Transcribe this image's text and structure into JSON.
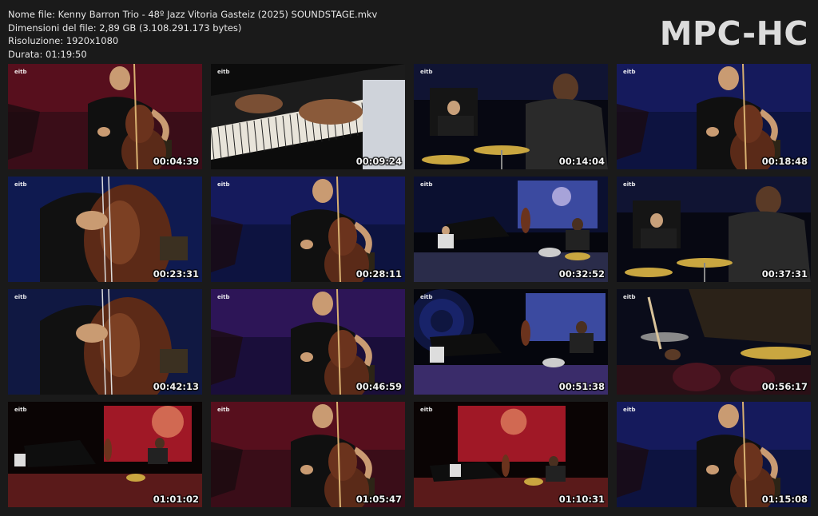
{
  "info": {
    "filename": "Nome file: Kenny Barron Trio - 48º Jazz Vitoria Gasteiz (2025) SOUNDSTAGE.mkv",
    "filesize": "Dimensioni del file: 2,89 GB (3.108.291.173 bytes)",
    "resolution": "Risoluzione: 1920x1080",
    "duration": "Durata: 01:19:50"
  },
  "brand": "MPC-HC",
  "channel_logo": "eitb",
  "thumbnails": [
    {
      "time": "00:04:39",
      "scene": "bassist-red"
    },
    {
      "time": "00:09:24",
      "scene": "piano-hands"
    },
    {
      "time": "00:14:04",
      "scene": "drummer-stage"
    },
    {
      "time": "00:18:48",
      "scene": "bassist-blue"
    },
    {
      "time": "00:23:31",
      "scene": "bass-closeup"
    },
    {
      "time": "00:28:11",
      "scene": "bassist-blue"
    },
    {
      "time": "00:32:52",
      "scene": "wide-stage-blue"
    },
    {
      "time": "00:37:31",
      "scene": "drummer-stage"
    },
    {
      "time": "00:42:13",
      "scene": "bass-hand"
    },
    {
      "time": "00:46:59",
      "scene": "bassist-purple"
    },
    {
      "time": "00:51:38",
      "scene": "wide-stage-spiral"
    },
    {
      "time": "00:56:17",
      "scene": "drum-closeup"
    },
    {
      "time": "01:01:02",
      "scene": "wide-stage-red"
    },
    {
      "time": "01:05:47",
      "scene": "bassist-red"
    },
    {
      "time": "01:10:31",
      "scene": "wide-stage-red-far"
    },
    {
      "time": "01:15:08",
      "scene": "bassist-blue"
    }
  ]
}
